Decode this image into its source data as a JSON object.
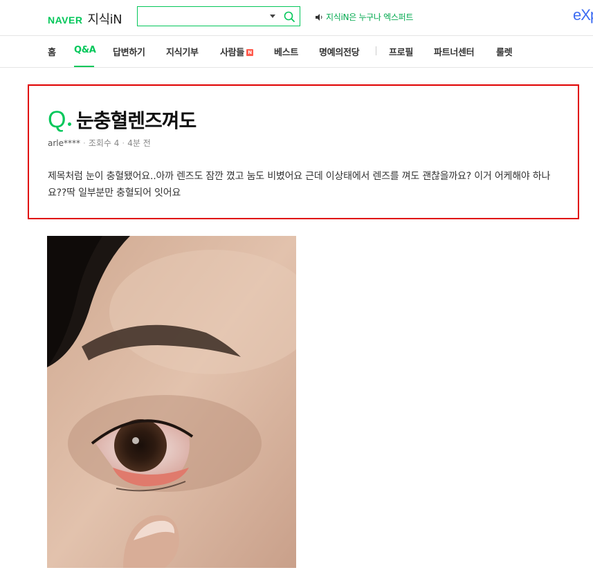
{
  "header": {
    "brand": "NAVER",
    "service": "지식iN",
    "search": {
      "value": "",
      "placeholder": ""
    },
    "notice": "지식iN은 누구나 엑스퍼트",
    "expert_logo": "eXp",
    "colors": {
      "accent": "#03c75a",
      "expert": "#3d6cf2"
    }
  },
  "nav": {
    "items": [
      {
        "label": "홈"
      },
      {
        "label": "Q&A",
        "active": true
      },
      {
        "label": "답변하기"
      },
      {
        "label": "지식기부"
      },
      {
        "label": "사람들",
        "badge": "N"
      },
      {
        "label": "베스트"
      },
      {
        "label": "명예의전당"
      },
      {
        "label": "프로필"
      },
      {
        "label": "파트너센터"
      },
      {
        "label": "룰렛"
      }
    ]
  },
  "question": {
    "marker": "Q",
    "title": "눈충혈렌즈껴도",
    "author": "arle****",
    "views_label": "조회수 4",
    "time": "4분 전",
    "body": "제목처럼 눈이 충혈됐어요..아까 렌즈도 잠깐 꼈고 눔도 비볐어요 근데 이상태에서 렌즈를 껴도 괜찮을까요? 이거 어케해야 하나요??딱 일부분만 충혈되어 잇어요",
    "highlight_color": "#e00000"
  },
  "attachment": {
    "icon": "photo-of-eye"
  }
}
